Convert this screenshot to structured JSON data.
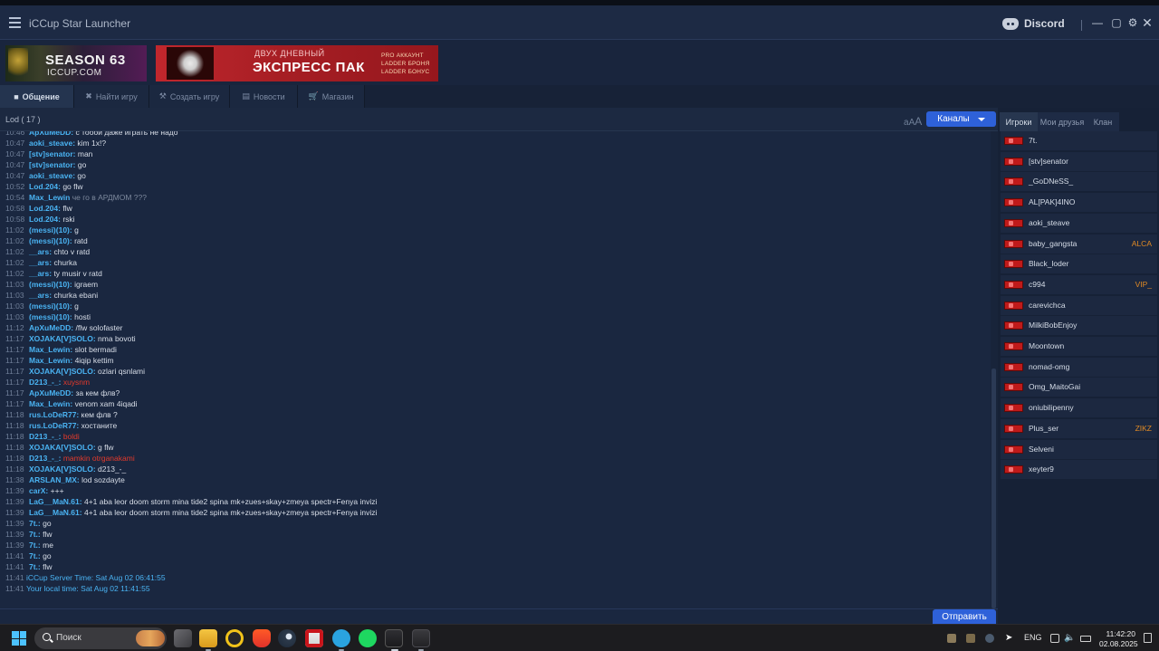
{
  "app": {
    "title": "iCCup Star Launcher",
    "discord_label": "Discord"
  },
  "banners": {
    "season": {
      "title": "SEASON 63",
      "subtitle": "ICCUP.COM"
    },
    "promo": {
      "top": "ДВУХ ДНЕВНЫЙ",
      "main": "ЭКСПРЕСС ПАК",
      "items": [
        "PRO АККАУНТ",
        "LADDER БРОНЯ",
        "LADDER БОНУС"
      ]
    }
  },
  "tabs": [
    {
      "label": "Общение",
      "icon": "chat-icon",
      "active": true
    },
    {
      "label": "Найти игру",
      "icon": "swords-icon"
    },
    {
      "label": "Создать игру",
      "icon": "wrench-icon"
    },
    {
      "label": "Новости",
      "icon": "news-icon"
    },
    {
      "label": "Магазин",
      "icon": "cart-icon"
    }
  ],
  "chat": {
    "channel": "Lod ( 17 )",
    "font_size_label_small": "a",
    "font_size_label_mid": "A",
    "font_size_label_big": "A",
    "channels_button": "Каналы",
    "send_button": "Отправить",
    "input_value": "",
    "messages": [
      {
        "time": "10:46",
        "nick": "ApXuMeDD:",
        "text": "с тобой даже играть не надо"
      },
      {
        "time": "10:47",
        "nick": "aoki_steave:",
        "text": "kim 1x!?"
      },
      {
        "time": "10:47",
        "nick": "[stv]senator:",
        "text": "man"
      },
      {
        "time": "10:47",
        "nick": "[stv]senator:",
        "text": "go"
      },
      {
        "time": "10:47",
        "nick": "aoki_steave:",
        "text": "go"
      },
      {
        "time": "10:52",
        "nick": "Lod.204:",
        "text": "go flw"
      },
      {
        "time": "10:54",
        "nick": "Max_Lewin",
        "text": "че го в АРДМОМ ???",
        "style": "gray"
      },
      {
        "time": "10:58",
        "nick": "Lod.204:",
        "text": "flw"
      },
      {
        "time": "10:58",
        "nick": "Lod.204:",
        "text": "rski"
      },
      {
        "time": "11:02",
        "nick": "(messi)(10):",
        "text": "g"
      },
      {
        "time": "11:02",
        "nick": "(messi)(10):",
        "text": "ratd"
      },
      {
        "time": "11:02",
        "nick": "__ars:",
        "text": "chto v ratd"
      },
      {
        "time": "11:02",
        "nick": "__ars:",
        "text": "churka"
      },
      {
        "time": "11:02",
        "nick": "__ars:",
        "text": "ty musir v ratd"
      },
      {
        "time": "11:03",
        "nick": "(messi)(10):",
        "text": "igraem"
      },
      {
        "time": "11:03",
        "nick": "__ars:",
        "text": "churka ebani"
      },
      {
        "time": "11:03",
        "nick": "(messi)(10):",
        "text": "g"
      },
      {
        "time": "11:03",
        "nick": "(messi)(10):",
        "text": "hosti"
      },
      {
        "time": "11:12",
        "nick": "ApXuMeDD:",
        "text": " /flw solofaster"
      },
      {
        "time": "11:17",
        "nick": "XOJAKA[V]SOLO:",
        "text": "nma bovoti"
      },
      {
        "time": "11:17",
        "nick": "Max_Lewin:",
        "text": "slot bermadi"
      },
      {
        "time": "11:17",
        "nick": "Max_Lewin:",
        "text": "4iqip kettim"
      },
      {
        "time": "11:17",
        "nick": "XOJAKA[V]SOLO:",
        "text": "ozlari qsnlami"
      },
      {
        "time": "11:17",
        "nick": "D213_-_:",
        "text": "xuysnm",
        "style": "red"
      },
      {
        "time": "11:17",
        "nick": "ApXuMeDD:",
        "text": "за кем флв?"
      },
      {
        "time": "11:17",
        "nick": "Max_Lewin:",
        "text": "venom xam 4iqadi"
      },
      {
        "time": "11:18",
        "nick": "rus.LoDeR77:",
        "text": "кем флв ?"
      },
      {
        "time": "11:18",
        "nick": "rus.LoDeR77:",
        "text": "хостаните"
      },
      {
        "time": "11:18",
        "nick": "D213_-_:",
        "text": "boldi",
        "style": "red"
      },
      {
        "time": "11:18",
        "nick": "XOJAKA[V]SOLO:",
        "text": "g flw"
      },
      {
        "time": "11:18",
        "nick": "D213_-_:",
        "text": "mamkin otrganakami",
        "style": "red"
      },
      {
        "time": "11:18",
        "nick": "XOJAKA[V]SOLO:",
        "text": "d213_-_"
      },
      {
        "time": "11:38",
        "nick": "ARSLAN_MX:",
        "text": "lod sozdayte"
      },
      {
        "time": "11:39",
        "nick": "carX:",
        "text": "+++"
      },
      {
        "time": "11:39",
        "nick": "LaG__MaN.61:",
        "text": "4+1 aba leor doom storm mina tide2 spina mk+zues+skay+zmeya spectr+Fenya invizi"
      },
      {
        "time": "11:39",
        "nick": "LaG__MaN.61:",
        "text": "4+1 aba leor doom storm mina tide2 spina mk+zues+skay+zmeya spectr+Fenya invizi"
      },
      {
        "time": "11:39",
        "nick": "7t.:",
        "text": "go"
      },
      {
        "time": "11:39",
        "nick": "7t.:",
        "text": "flw"
      },
      {
        "time": "11:39",
        "nick": "7t.:",
        "text": "me"
      },
      {
        "time": "11:41",
        "nick": "7t.:",
        "text": "go"
      },
      {
        "time": "11:41",
        "nick": "7t.:",
        "text": "flw"
      }
    ],
    "system": [
      {
        "time": "11:41",
        "text": "iCCup Server Time: Sat Aug 02 06:41:55"
      },
      {
        "time": "11:41",
        "text": "Your local time: Sat Aug 02 11:41:55"
      }
    ]
  },
  "side": {
    "tabs": [
      {
        "label": "Игроки",
        "active": true
      },
      {
        "label": "Мои друзья"
      },
      {
        "label": "Клан"
      }
    ],
    "players": [
      {
        "name": "7t.",
        "clan": ""
      },
      {
        "name": "[stv]senator",
        "clan": ""
      },
      {
        "name": "_GoDNeSS_",
        "clan": ""
      },
      {
        "name": "AL[PAK]4INO",
        "clan": ""
      },
      {
        "name": "aoki_steave",
        "clan": ""
      },
      {
        "name": "baby_gangsta",
        "clan": "ALCA"
      },
      {
        "name": "Black_loder",
        "clan": ""
      },
      {
        "name": "c994",
        "clan": "VIP_"
      },
      {
        "name": "carevichca",
        "clan": ""
      },
      {
        "name": "MilkiBobEnjoy",
        "clan": ""
      },
      {
        "name": "Moontown",
        "clan": ""
      },
      {
        "name": "nomad-omg",
        "clan": ""
      },
      {
        "name": "Omg_MaitoGai",
        "clan": ""
      },
      {
        "name": "oniubilipenny",
        "clan": ""
      },
      {
        "name": "Plus_ser",
        "clan": "ZIKZ"
      },
      {
        "name": "Selveni",
        "clan": ""
      },
      {
        "name": "xeyter9",
        "clan": ""
      }
    ]
  },
  "taskbar": {
    "search_placeholder": "Поиск",
    "lang": "ENG",
    "time": "11:42:20",
    "date": "02.08.2025",
    "colors": {
      "accent": "#2e61d9",
      "nick": "#4ab3f2",
      "red_text": "#e23a2b",
      "clan": "#e08a24"
    }
  }
}
